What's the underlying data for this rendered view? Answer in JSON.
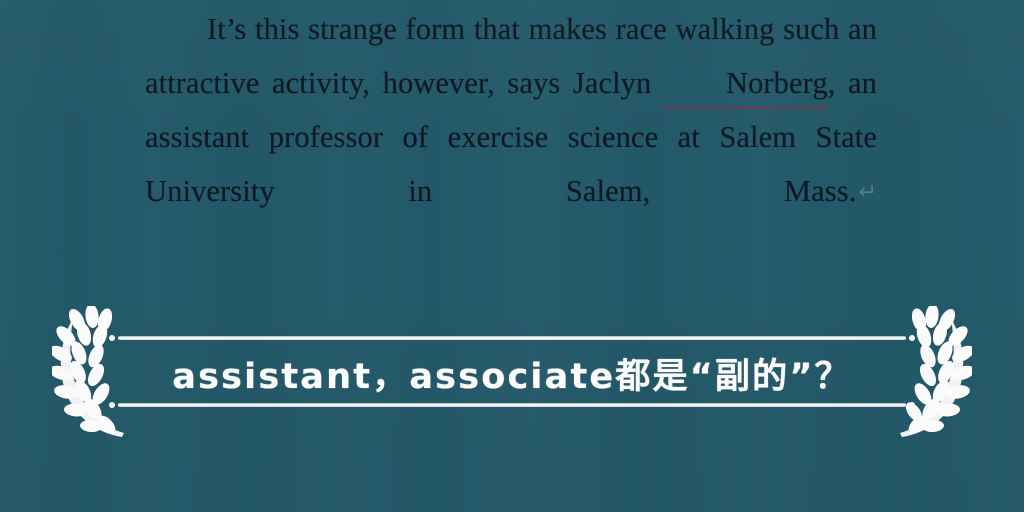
{
  "colors": {
    "background": "#23596a",
    "body_text": "#0d1720",
    "banner_white": "#ffffff",
    "spellcheck_underline": "#9d2233",
    "paragraph_mark": "#5a7f8c"
  },
  "document": {
    "paragraph": {
      "segment_1": "It’s this strange form that makes race walking such an attractive activity, however, says Jaclyn ",
      "misspelled_word": "Norberg",
      "segment_2": ", an assistant professor of exercise science at Salem State University in Salem, Mass.",
      "paragraph_mark": "↵"
    }
  },
  "banner": {
    "title": "assistant，associate都是“副的”？",
    "left_ornament": "laurel-branch-icon",
    "right_ornament": "laurel-branch-icon"
  }
}
